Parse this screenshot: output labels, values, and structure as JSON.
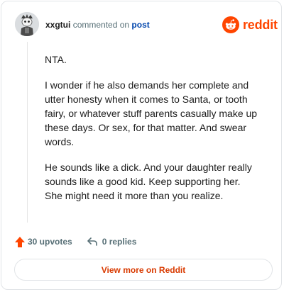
{
  "header": {
    "username": "xxgtui",
    "action_text": "commented on",
    "post_link": "post",
    "logo_text": "reddit"
  },
  "comment": {
    "paragraphs": [
      "NTA.",
      "I wonder if he also demands her complete and utter honesty when it comes to Santa, or tooth fairy, or whatever stuff parents casually make up these days. Or sex, for that matter. And swear words.",
      "He sounds like a dick. And your daughter really sounds like a good kid. Keep supporting her. She might need it more than you realize."
    ]
  },
  "footer": {
    "upvotes_label": "30 upvotes",
    "replies_label": "0 replies",
    "view_more_label": "View more on Reddit"
  },
  "colors": {
    "brand": "#ff4500",
    "link": "#0045ac",
    "view_more_text": "#d93a00"
  }
}
